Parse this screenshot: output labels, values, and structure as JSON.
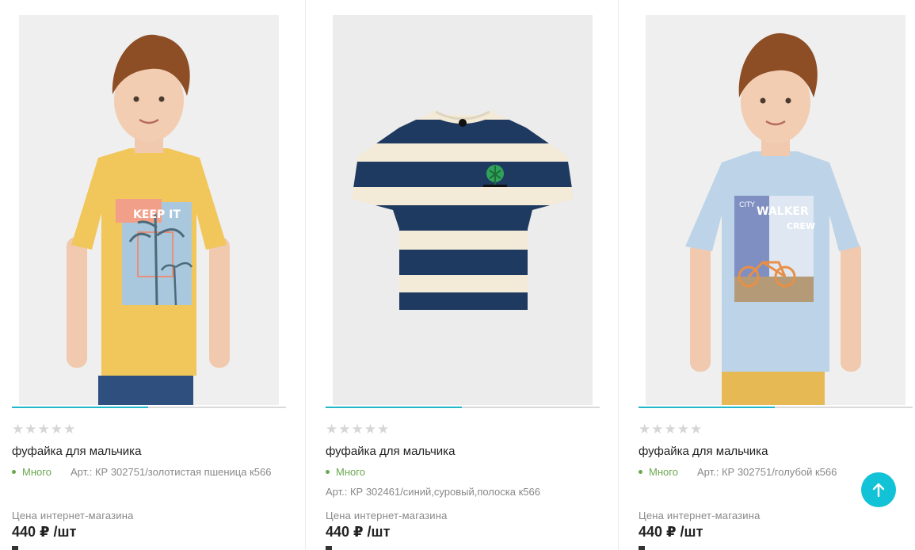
{
  "products": [
    {
      "image_alt": "boy-yellow-tshirt",
      "stars": "★★★★★",
      "title": "фуфайка для мальчика",
      "stock": "Много",
      "article": "Арт.: КР 302751/золотистая пшеница к566",
      "price_label": "Цена интернет-магазина",
      "price": "440 ₽ /шт"
    },
    {
      "image_alt": "striped-tshirt",
      "stars": "★★★★★",
      "title": "фуфайка для мальчика",
      "stock": "Много",
      "article": "Арт.: КР 302461/синий,суровый,полоска к566",
      "price_label": "Цена интернет-магазина",
      "price": "440 ₽ /шт"
    },
    {
      "image_alt": "boy-blue-tshirt",
      "stars": "★★★★★",
      "title": "фуфайка для мальчика",
      "stock": "Много",
      "article": "Арт.: КР 302751/голубой к566",
      "price_label": "Цена интернет-магазина",
      "price": "440 ₽ /шт"
    }
  ],
  "prints": {
    "keep": "KEEP IT",
    "city": "CITY",
    "walker": "WALKER",
    "crew": "CREW"
  },
  "colors": {
    "accent": "#12c2d6",
    "stock_green": "#6aa84f",
    "slider_active": "#1fb7c9"
  },
  "scroll_top": {
    "icon": "arrow-up-icon"
  }
}
